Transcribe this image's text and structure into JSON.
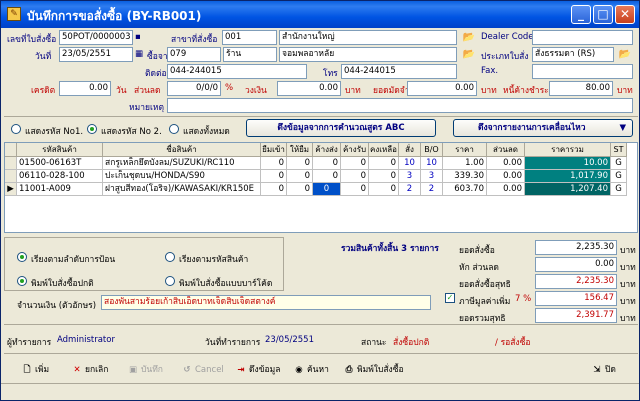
{
  "window": {
    "title": "บันทึกการขอสั่งซื้อ (BY-RB001)"
  },
  "header": {
    "doc_no_label": "เลขที่ใบสั่งซื้อ",
    "doc_no": "50POT/0000003",
    "date_label": "วันที่",
    "date": "23/05/2551",
    "branch_label": "สาขาที่สั่งซื้อ",
    "branch_code": "001",
    "branch_name": "สำนักงานใหญ่",
    "supplier_label": "ซื้อจาก",
    "supplier_code": "079",
    "supplier_type": "ร้าน",
    "supplier_name": "จอมพลอาหลัย",
    "contact_label": "ติดต่อ",
    "contact": "044-244015",
    "phone_label": "โทร",
    "phone": "044-244015",
    "dealer_label": "Dealer Code :",
    "dealer_code": "",
    "sale_type_label": "ประเภทใบสั่ง :",
    "sale_type": "สั่งธรรมดา (RS)",
    "fax_label": "Fax.",
    "fax": "",
    "credit_label": "เครดิต",
    "credit": "0.00",
    "credit_unit": "วัน",
    "discount_label": "ส่วนลด",
    "discount": "0/0/0",
    "discount_unit": "%",
    "limit_label": "วงเงิน",
    "limit": "0.00",
    "limit_unit": "บาท",
    "deposit_label": "ยอดมัดจำ",
    "deposit": "0.00",
    "deposit_unit": "บาท",
    "tax_label": "หนี้ค้างชำระ",
    "tax": "80.00",
    "tax_unit": "บาท",
    "remark_label": "หมายเหตุ",
    "remark": ""
  },
  "options": {
    "radio1": "แสดงรหัส No1.",
    "radio2": "แสดงรหัส No 2.",
    "radio3": "แสดงทั้งหมด",
    "selected": 2,
    "formula_button": "ดึงข้อมูลจากการคำนวณสูตร ABC",
    "report_button": "ดึงจากรายงานการเคลื่อนไหว"
  },
  "table": {
    "columns": [
      "รหัสสินค้า",
      "ชื่อสินค้า",
      "ยืมเข้า",
      "ให้ยืม",
      "ค้างส่ง",
      "ค้างรับ",
      "คงเหลือ",
      "สั่ง",
      "B/O",
      "ราคา",
      "ส่วนลด",
      "ราคารวม",
      "ST"
    ],
    "rows": [
      [
        "01500-06163T",
        "สกรูเหล็กยึดบังลม/SUZUKI/RC110",
        "0",
        "0",
        "0",
        "0",
        "0",
        "10",
        "10",
        "1.00",
        "0.00",
        "10.00",
        "G"
      ],
      [
        "06110-028-100",
        "ปะเก็นชุดบน/HONDA/S90",
        "0",
        "0",
        "0",
        "0",
        "0",
        "3",
        "3",
        "339.30",
        "0.00",
        "1,017.90",
        "G"
      ],
      [
        "11001-A009",
        "ฝาสูบสีทอง(โอริจ)/KAWASAKI/KR150E",
        "0",
        "0",
        "0",
        "0",
        "0",
        "2",
        "2",
        "603.70",
        "0.00",
        "1,207.40",
        "G"
      ]
    ]
  },
  "sorting": {
    "sort1": "เรียงตามลำดับการป้อน",
    "sort2": "เรียงตามรหัสสินค้า",
    "print1": "พิมพ์ใบสั่งซื้อปกติ",
    "print2": "พิมพ์ใบสั่งซื้อแบบบาร์โค้ด"
  },
  "summary": {
    "count_text": "รวมสินค้าทั้งสิ้น  3  รายการ",
    "total_label": "ยอดสั่งซื้อ",
    "total": "2,235.30",
    "disc_label": "หัก ส่วนลด",
    "disc": "0.00",
    "net_label": "ยอดสั่งซื้อสุทธิ",
    "net": "2,235.30",
    "vat_label": "ภาษีมูลค่าเพิ่ม",
    "vat_rate": "7 %",
    "vat": "156.47",
    "grand_label": "ยอดรวมสุทธิ",
    "grand": "2,391.77",
    "unit": "บาท",
    "words_label": "จำนวนเงิน (ตัวอักษร)",
    "words": "สองพันสามร้อยเก้าสิบเอ็ดบาทเจ็ดสิบเจ็ดสตางค์"
  },
  "status": {
    "user_label": "ผู้ทำรายการ",
    "user": "Administrator",
    "date_label": "วันที่ทำรายการ",
    "date": "23/05/2551",
    "state_label": "สถานะ",
    "state": "สั่งซื้อปกติ",
    "state2": "/  รอสั่งซื้อ"
  },
  "toolbar": {
    "add": "เพิ่ม",
    "cancel_doc": "ยกเลิก",
    "save": "บันทึก",
    "cancel": "Cancel",
    "fetch": "ดึงข้อมูล",
    "search": "ค้นหา",
    "print": "พิมพ์ใบสั่งซื้อ",
    "close": "ปิด"
  },
  "colors": {
    "title_bar": "#0054e3",
    "label": "#000080",
    "total_cell": "#008080",
    "red_text": "#c00000"
  }
}
